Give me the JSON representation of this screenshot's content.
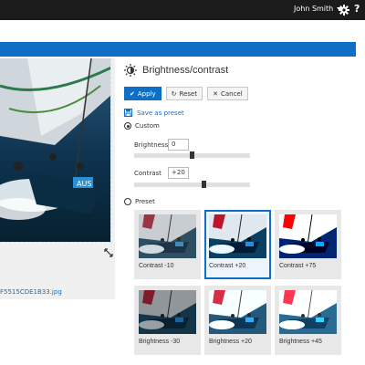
{
  "header": {
    "user_name": "John Smith",
    "help_label": "?"
  },
  "image_panel": {
    "filename": "F5515CDE1B33.jpg"
  },
  "editor": {
    "title": "Brightness/contrast",
    "buttons": {
      "apply": "Apply",
      "reset": "Reset",
      "cancel": "Cancel"
    },
    "save_preset": "Save as preset",
    "custom_label": "Custom",
    "brightness_label": "Brightness",
    "brightness_value": "0",
    "brightness_level": 0.5,
    "contrast_label": "Contrast",
    "contrast_value": "+20",
    "contrast_level": 0.6,
    "preset_label": "Preset",
    "mode": "custom",
    "presets": [
      {
        "label": "Contrast -10",
        "selected": false
      },
      {
        "label": "Contrast +20",
        "selected": true
      },
      {
        "label": "Contrast +75",
        "selected": false
      },
      {
        "label": "Brightness -30",
        "selected": false
      },
      {
        "label": "Brightness +20",
        "selected": false
      },
      {
        "label": "Brightness +45",
        "selected": false
      }
    ]
  },
  "colors": {
    "accent": "#0f6fc6",
    "topbar": "#1b1b1b"
  }
}
